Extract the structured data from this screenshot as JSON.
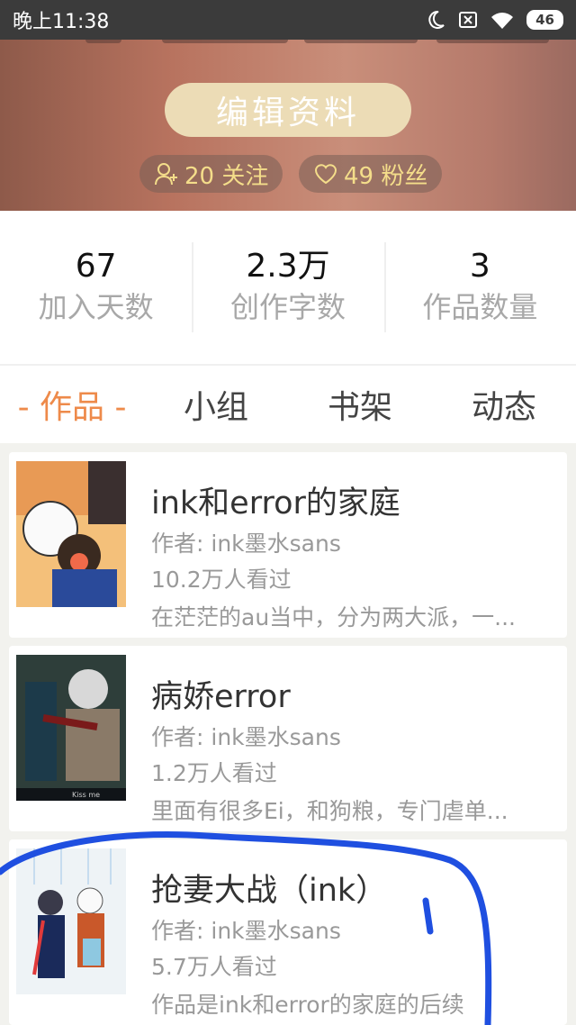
{
  "status_bar": {
    "time": "晚上11:38",
    "battery": "46"
  },
  "profile": {
    "edit_label": "编辑资料",
    "following_label": "20 关注",
    "followers_label": "49 粉丝"
  },
  "stats": [
    {
      "value": "67",
      "label": "加入天数"
    },
    {
      "value": "2.3万",
      "label": "创作字数"
    },
    {
      "value": "3",
      "label": "作品数量"
    }
  ],
  "tabs": {
    "works": "- 作品 -",
    "groups": "小组",
    "bookshelf": "书架",
    "moments": "动态"
  },
  "works": [
    {
      "title": "ink和error的家庭",
      "author": "作者: ink墨水sans",
      "views": "10.2万人看过",
      "desc": "在茫茫的au当中，分为两大派，一..."
    },
    {
      "title": "病娇error",
      "author": "作者: ink墨水sans",
      "views": "1.2万人看过",
      "desc": "里面有很多Ei，和狗粮，专门虐单...",
      "cover_caption": "Kiss me"
    },
    {
      "title": "抢妻大战（ink）",
      "author": "作者: ink墨水sans",
      "views": "5.7万人看过",
      "desc": "作品是ink和error的家庭的后续"
    }
  ],
  "colors": {
    "accent": "#ee8a4a",
    "chip_text": "#f4dd8a",
    "edit_button": "#ecdcb6",
    "annotation": "#1f4fe0"
  }
}
